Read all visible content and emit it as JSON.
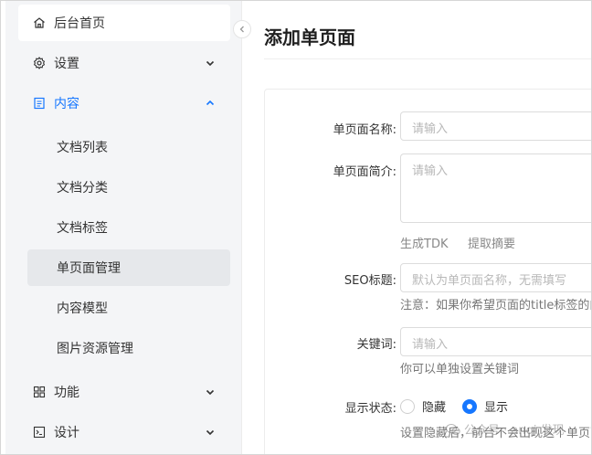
{
  "sidebar": {
    "items": [
      {
        "label": "后台首页",
        "icon": "home-icon"
      },
      {
        "label": "设置",
        "icon": "gear-icon"
      },
      {
        "label": "内容",
        "icon": "document-icon"
      },
      {
        "label": "功能",
        "icon": "grid-icon"
      },
      {
        "label": "设计",
        "icon": "terminal-icon"
      }
    ],
    "content_sub": [
      {
        "label": "文档列表"
      },
      {
        "label": "文档分类"
      },
      {
        "label": "文档标签"
      },
      {
        "label": "单页面管理"
      },
      {
        "label": "内容模型"
      },
      {
        "label": "图片资源管理"
      }
    ]
  },
  "colors": {
    "accent": "#1677ff"
  },
  "main": {
    "title": "添加单页面",
    "form": {
      "name_label": "单页面名称:",
      "name_placeholder": "请输入",
      "desc_label": "单页面简介:",
      "desc_placeholder": "请输入",
      "gen_tdk": "生成TDK",
      "extract_summary": "提取摘要",
      "seo_label": "SEO标题:",
      "seo_placeholder": "默认为单页面名称，无需填写",
      "seo_help": "注意：如果你希望页面的title标签的内",
      "keywords_label": "关键词:",
      "keywords_placeholder": "请输入",
      "keywords_help": "你可以单独设置关键词",
      "status_label": "显示状态:",
      "status_hide": "隐藏",
      "status_show": "显示",
      "status_selected": "显示",
      "status_help": "设置隐藏后，前台不会出现这个单页面"
    }
  },
  "watermark": "公众号 · anqi 发现"
}
